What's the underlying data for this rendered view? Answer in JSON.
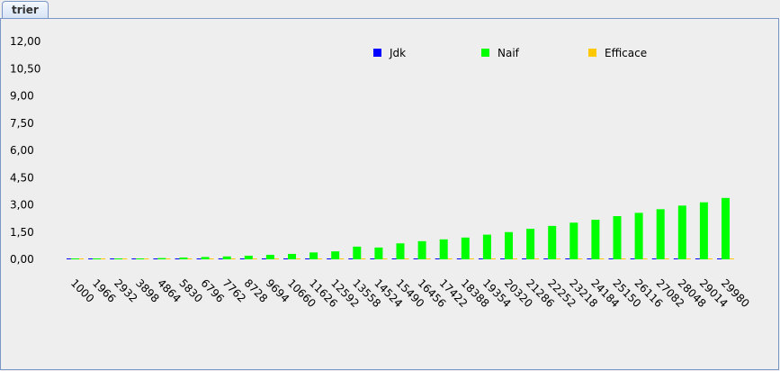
{
  "window": {
    "tab_label": "trier"
  },
  "chart_data": {
    "type": "bar",
    "title": "",
    "xlabel": "",
    "ylabel": "",
    "ylim": [
      0,
      12
    ],
    "yticks": [
      "0,00",
      "1,50",
      "3,00",
      "4,50",
      "6,00",
      "7,50",
      "9,00",
      "10,50",
      "12,00"
    ],
    "grid": false,
    "legend_position": "top-right",
    "categories": [
      "1000",
      "1966",
      "2932",
      "3898",
      "4864",
      "5830",
      "6796",
      "7762",
      "8728",
      "9694",
      "10660",
      "11626",
      "12592",
      "13558",
      "14524",
      "15490",
      "16456",
      "17422",
      "18388",
      "19354",
      "20320",
      "21286",
      "22252",
      "23218",
      "24184",
      "25150",
      "26116",
      "27082",
      "28048",
      "29014",
      "29980"
    ],
    "series": [
      {
        "name": "Jdk",
        "color": "#0000ff",
        "values": [
          0,
          0,
          0,
          0,
          0,
          0,
          0,
          0,
          0,
          0,
          0,
          0,
          0,
          0,
          0,
          0,
          0,
          0,
          0,
          0,
          0,
          0,
          0,
          0,
          0,
          0,
          0,
          0,
          0,
          0,
          0
        ]
      },
      {
        "name": "Naif",
        "color": "#00ff00",
        "values": [
          0.005,
          0.02,
          0.04,
          0.05,
          0.07,
          0.1,
          0.13,
          0.16,
          0.2,
          0.25,
          0.3,
          0.38,
          0.44,
          0.7,
          0.65,
          0.88,
          1.0,
          1.1,
          1.2,
          1.36,
          1.5,
          1.68,
          1.84,
          2.02,
          2.18,
          2.38,
          2.56,
          2.76,
          2.96,
          3.14,
          3.38
        ]
      },
      {
        "name": "Efficace",
        "color": "#ffc800",
        "values": [
          0,
          0,
          0,
          0,
          0,
          0,
          0,
          0,
          0,
          0,
          0,
          0,
          0,
          0,
          0,
          0,
          0,
          0,
          0,
          0,
          0,
          0,
          0,
          0,
          0,
          0,
          0,
          0,
          0,
          0,
          0
        ]
      }
    ]
  }
}
